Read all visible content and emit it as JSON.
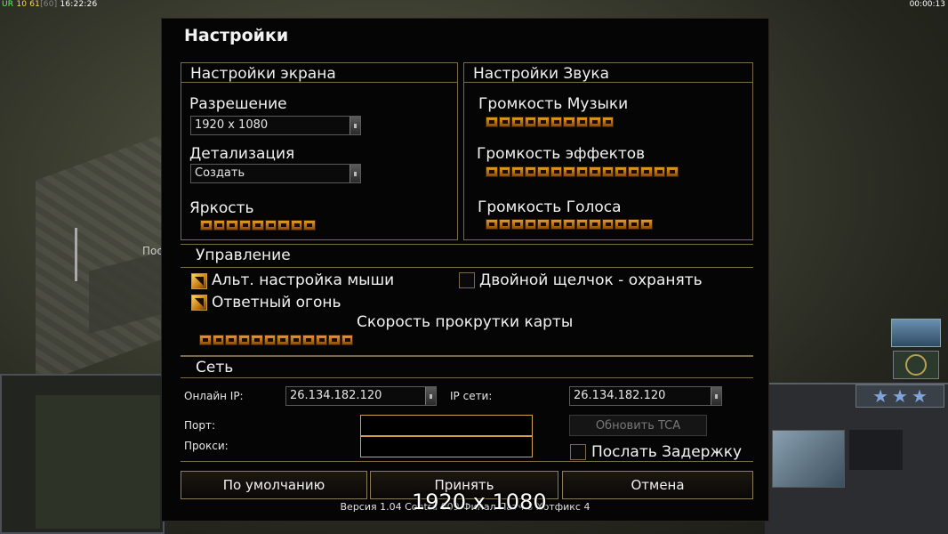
{
  "overlay": {
    "fps": {
      "label": "UR",
      "a": "10",
      "b": "61",
      "c": "[60]",
      "time": "16:22:26"
    },
    "clock": "00:00:13",
    "scene_label": "Посто",
    "resolution_watermark": "1920 x 1080"
  },
  "dialog": {
    "title": "Настройки",
    "screen": {
      "header": "Настройки экрана",
      "resolution_label": "Разрешение",
      "resolution_value": "1920 x 1080",
      "detail_label": "Детализация",
      "detail_value": "Создать",
      "brightness_label": "Яркость",
      "brightness_level": 9
    },
    "sound": {
      "header": "Настройки Звука",
      "music_label": "Громкость Музыки",
      "music_level": 10,
      "effects_label": "Громкость эффектов",
      "effects_level": 15,
      "voice_label": "Громкость Голоса",
      "voice_level": 13
    },
    "controls": {
      "header": "Управление",
      "alt_mouse_label": "Альт. настройка мыши",
      "alt_mouse_checked": true,
      "double_click_label": "Двойной щелчок - охранять",
      "double_click_checked": false,
      "return_fire_label": "Ответный огонь",
      "return_fire_checked": true,
      "scroll_label": "Скорость прокрутки карты",
      "scroll_level": 12
    },
    "network": {
      "header": "Сеть",
      "online_ip_label": "Онлайн IP:",
      "online_ip_value": "26.134.182.120",
      "net_ip_label": "IP сети:",
      "net_ip_value": "26.134.182.120",
      "port_label": "Порт:",
      "proxy_label": "Прокси:",
      "update_tca_label": "Обновить TCA",
      "send_delay_label": "Послать Задержку",
      "send_delay_checked": false
    },
    "buttons": {
      "default_label": "По умолчанию",
      "accept_label": "Принять",
      "cancel_label": "Отмена"
    },
    "version": "Версия 1.04 Contra 009 Финал Патч 3 Хотфикс 4"
  },
  "colors": {
    "accent_border": "#7a6a48",
    "slider_orange": "#e79a23",
    "input_border": "#d2a14a"
  }
}
